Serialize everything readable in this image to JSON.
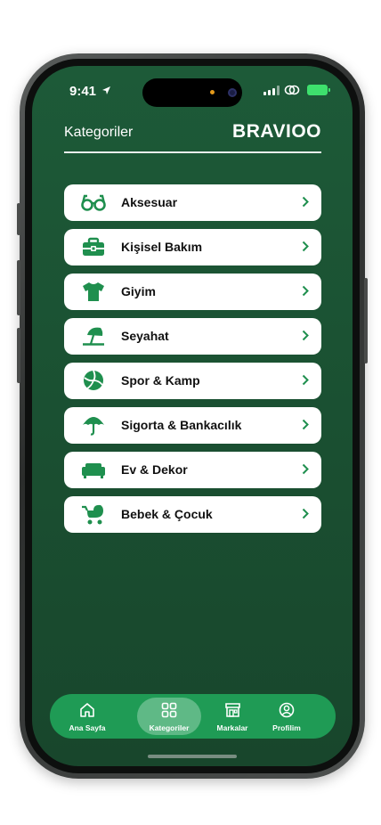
{
  "status_bar": {
    "time": "9:41"
  },
  "header": {
    "title": "Kategoriler",
    "brand": "BRAVIOO"
  },
  "categories": [
    {
      "label": "Aksesuar",
      "icon": "glasses-icon"
    },
    {
      "label": "Kişisel Bakım",
      "icon": "toolbox-icon"
    },
    {
      "label": "Giyim",
      "icon": "tshirt-icon"
    },
    {
      "label": "Seyahat",
      "icon": "beach-umbrella-icon"
    },
    {
      "label": "Spor & Kamp",
      "icon": "volleyball-icon"
    },
    {
      "label": "Sigorta & Bankacılık",
      "icon": "umbrella-icon"
    },
    {
      "label": "Ev & Dekor",
      "icon": "sofa-icon"
    },
    {
      "label": "Bebek & Çocuk",
      "icon": "stroller-icon"
    }
  ],
  "tabbar": {
    "items": [
      {
        "label": "Ana Sayfa",
        "icon": "home-icon",
        "active": false
      },
      {
        "label": "Kategoriler",
        "icon": "grid-icon",
        "active": true
      },
      {
        "label": "Markalar",
        "icon": "store-icon",
        "active": false
      },
      {
        "label": "Profilim",
        "icon": "user-icon",
        "active": false
      }
    ]
  },
  "colors": {
    "background": "#1d5a38",
    "accent": "#1f9b55",
    "icon": "#1f8f4e"
  }
}
